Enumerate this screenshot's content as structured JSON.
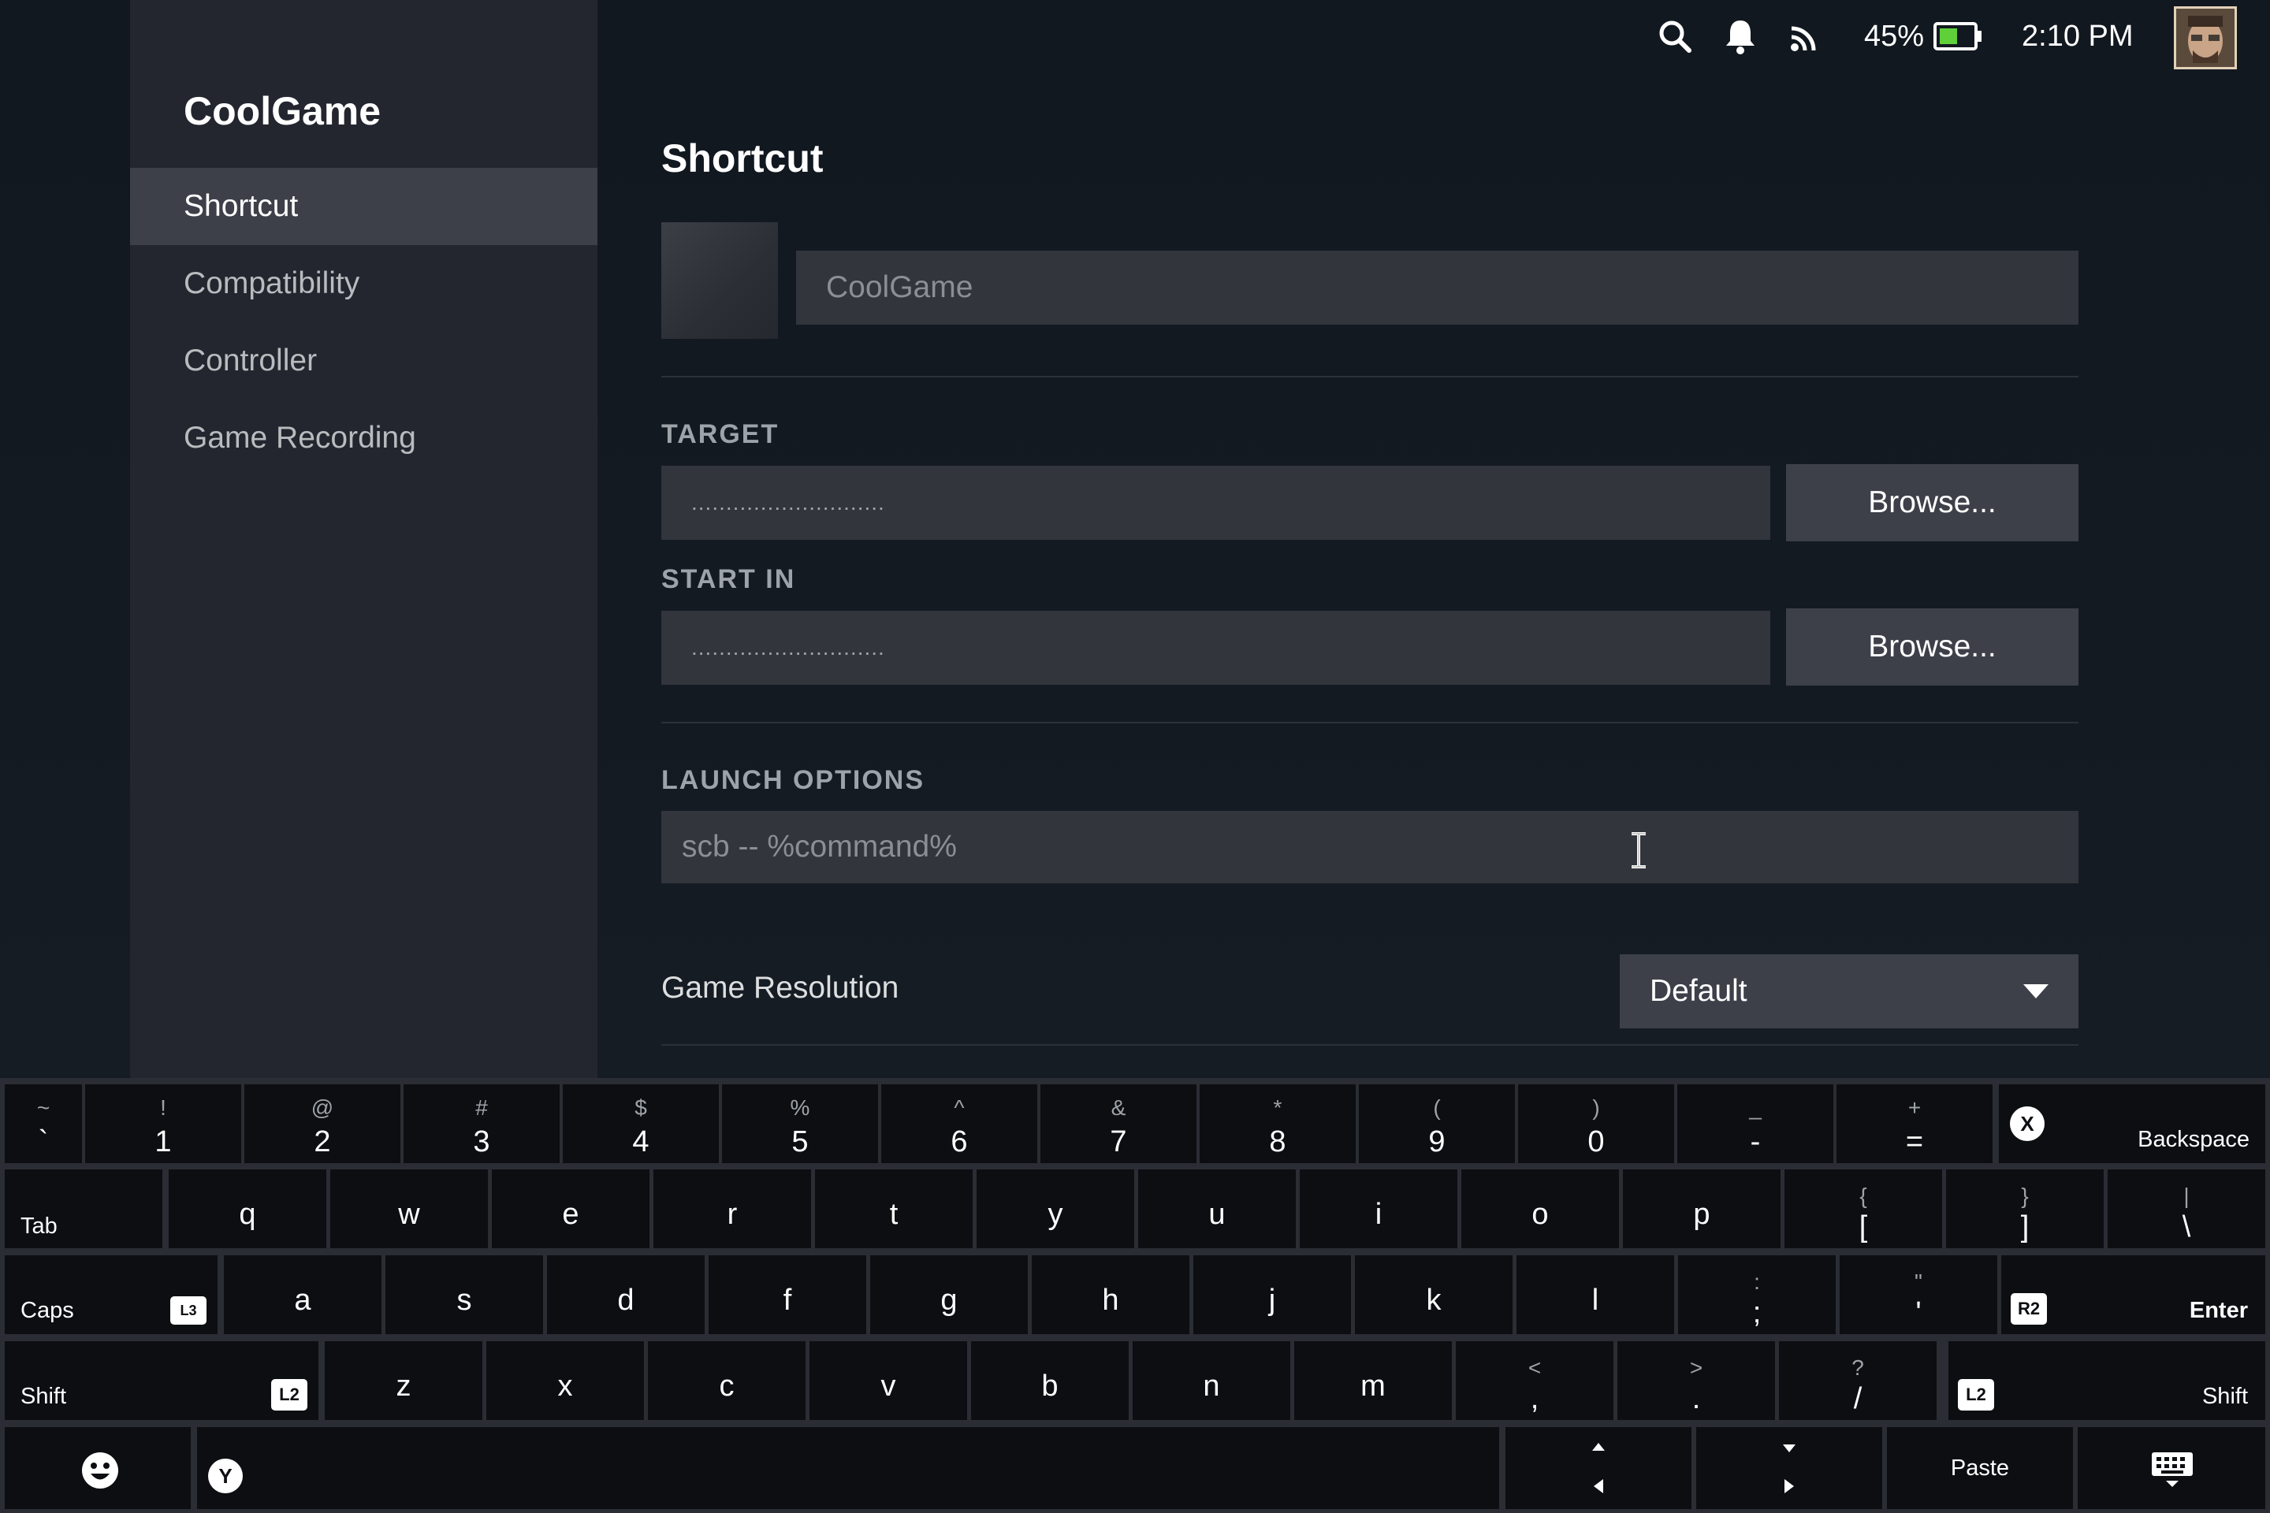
{
  "sidebar": {
    "title": "CoolGame",
    "items": [
      {
        "label": "Shortcut",
        "active": true
      },
      {
        "label": "Compatibility",
        "active": false
      },
      {
        "label": "Controller",
        "active": false
      },
      {
        "label": "Game Recording",
        "active": false
      }
    ]
  },
  "topbar": {
    "icons": [
      "search-icon",
      "bell-icon",
      "cast-icon",
      "battery-icon",
      "avatar"
    ],
    "battery": "45%",
    "clock": "2:10 PM"
  },
  "main": {
    "title": "Shortcut",
    "name_value": "CoolGame",
    "target_label": "TARGET",
    "target_value": "............................",
    "start_in_label": "START IN",
    "start_in_value": "............................",
    "browse_label": "Browse...",
    "launch_label": "LAUNCH OPTIONS",
    "launch_value": "scb -- %command%",
    "resolution_label": "Game Resolution",
    "resolution_value": "Default"
  },
  "keyboard": {
    "row1": [
      {
        "shift": "~",
        "main": "`"
      },
      {
        "shift": "!",
        "main": "1"
      },
      {
        "shift": "@",
        "main": "2"
      },
      {
        "shift": "#",
        "main": "3"
      },
      {
        "shift": "$",
        "main": "4"
      },
      {
        "shift": "%",
        "main": "5"
      },
      {
        "shift": "^",
        "main": "6"
      },
      {
        "shift": "&",
        "main": "7"
      },
      {
        "shift": "*",
        "main": "8"
      },
      {
        "shift": "(",
        "main": "9"
      },
      {
        "shift": ")",
        "main": "0"
      },
      {
        "shift": "_",
        "main": "-"
      },
      {
        "shift": "+",
        "main": "="
      }
    ],
    "backspace": "Backspace",
    "backspace_badge": "X",
    "tab": "Tab",
    "row2": [
      "q",
      "w",
      "e",
      "r",
      "t",
      "y",
      "u",
      "i",
      "o",
      "p"
    ],
    "row2_sym": [
      {
        "shift": "{",
        "main": "["
      },
      {
        "shift": "}",
        "main": "]"
      },
      {
        "shift": "|",
        "main": "\\"
      }
    ],
    "caps": "Caps",
    "caps_badge": "L3",
    "row3": [
      "a",
      "s",
      "d",
      "f",
      "g",
      "h",
      "j",
      "k",
      "l"
    ],
    "row3_sym": [
      {
        "shift": ":",
        "main": ";"
      },
      {
        "shift": "\"",
        "main": "'"
      }
    ],
    "enter": "Enter",
    "enter_badge": "R2",
    "shift": "Shift",
    "shift_badge": "L2",
    "row4": [
      "z",
      "x",
      "c",
      "v",
      "b",
      "n",
      "m"
    ],
    "row4_sym": [
      {
        "shift": "<",
        "main": ","
      },
      {
        "shift": ">",
        "main": "."
      },
      {
        "shift": "?",
        "main": "/"
      }
    ],
    "space_badge": "Y",
    "paste": "Paste"
  }
}
